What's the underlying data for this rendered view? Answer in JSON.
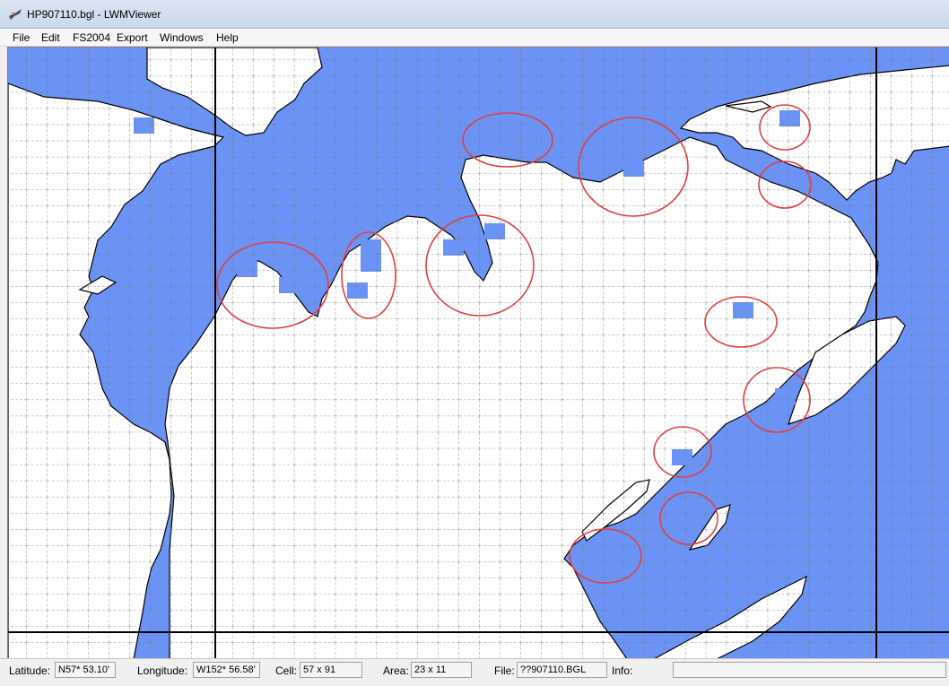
{
  "window": {
    "title": "HP907110.bgl - LWMViewer"
  },
  "menu": {
    "items": [
      "File",
      "Edit",
      "FS2004",
      "Export",
      "Windows",
      "Help"
    ]
  },
  "map": {
    "water_color": "#6b93f5",
    "land_color": "#ffffff",
    "grid_color": "#555555",
    "boundary_color": "#000000",
    "annotation_color": "#e04040"
  },
  "status": {
    "latitude_label": "Latitude:",
    "latitude_value": "N57* 53.10'",
    "longitude_label": "Longitude:",
    "longitude_value": "W152* 56.58'",
    "cell_label": "Cell:",
    "cell_value": "57 x 91",
    "area_label": "Area:",
    "area_value": "23 x 11",
    "file_label": "File:",
    "file_value": "??907110.BGL",
    "info_label": "Info:",
    "info_value": ""
  }
}
